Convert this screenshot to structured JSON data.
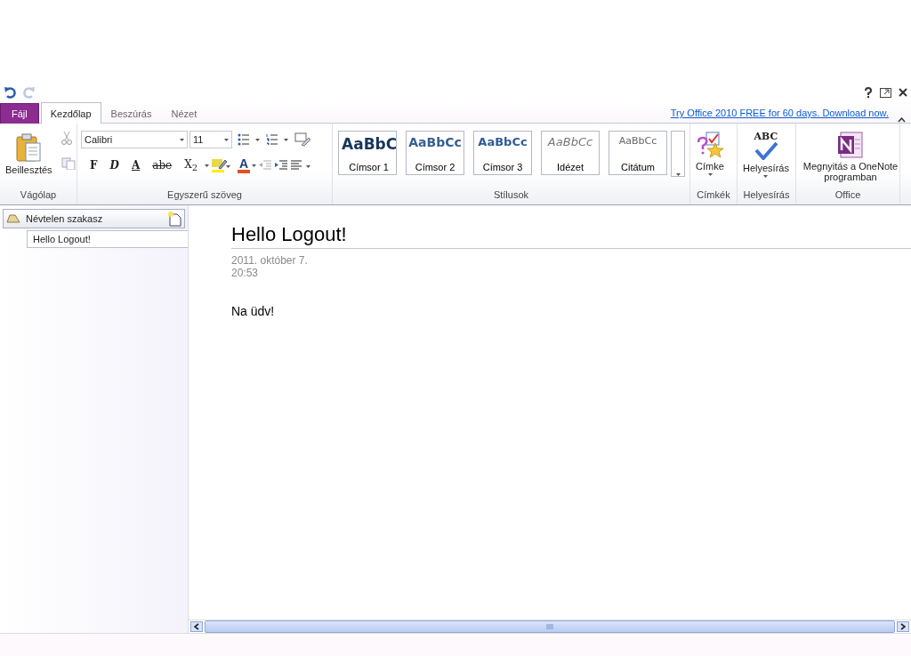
{
  "tabs": [
    {
      "label": "Fájl",
      "kind": "file",
      "selected": false
    },
    {
      "label": "Kezdőlap",
      "kind": "tab",
      "selected": true
    },
    {
      "label": "Beszúrás",
      "kind": "tab",
      "selected": false
    },
    {
      "label": "Nézet",
      "kind": "tab",
      "selected": false
    }
  ],
  "promo_link": "Try Office 2010 FREE for 60 days. Download now.",
  "ribbon": {
    "groups": [
      {
        "kind": "clipboard",
        "name": "Vágólap",
        "paste": "Beillesztés"
      },
      {
        "kind": "text",
        "name": "Egyszerű szöveg",
        "font": "Calibri",
        "size": "11",
        "format_buttons": [
          {
            "kind": "bold",
            "label": "F"
          },
          {
            "kind": "italic",
            "label": "D"
          },
          {
            "kind": "underline",
            "label": "A"
          },
          {
            "kind": "strike",
            "label": "abe"
          },
          {
            "kind": "subscript",
            "label": "X$_{2}$"
          }
        ],
        "font_color_label": "A"
      },
      {
        "kind": "styles",
        "name": "Stílusok",
        "styles": [
          {
            "preview": "AaBbC",
            "label": "Címsor 1",
            "kind": "h1"
          },
          {
            "preview": "AaBbCc",
            "label": "Címsor 2",
            "kind": "h2"
          },
          {
            "preview": "AaBbCc",
            "label": "Címsor 3",
            "kind": "h3"
          },
          {
            "preview": "AaBbCc",
            "label": "Idézet",
            "kind": "quote"
          },
          {
            "preview": "AaBbCc",
            "label": "Citátum",
            "kind": "cite"
          }
        ]
      },
      {
        "kind": "tags",
        "name": "Címkék",
        "button": "Címke"
      },
      {
        "kind": "spelling",
        "name": "Helyesírás",
        "button": "Helyesírás",
        "icon_text": "ABC"
      },
      {
        "kind": "office",
        "name": "Office",
        "button": "Megnyitás a OneNote programban"
      }
    ]
  },
  "sidebar": {
    "section": "Névtelen szakasz",
    "pages": [
      {
        "title": "Hello Logout!",
        "selected": true
      }
    ]
  },
  "page": {
    "title": "Hello Logout!",
    "date": "2011. október 7.",
    "time": "20:53",
    "body": "Na üdv!"
  }
}
